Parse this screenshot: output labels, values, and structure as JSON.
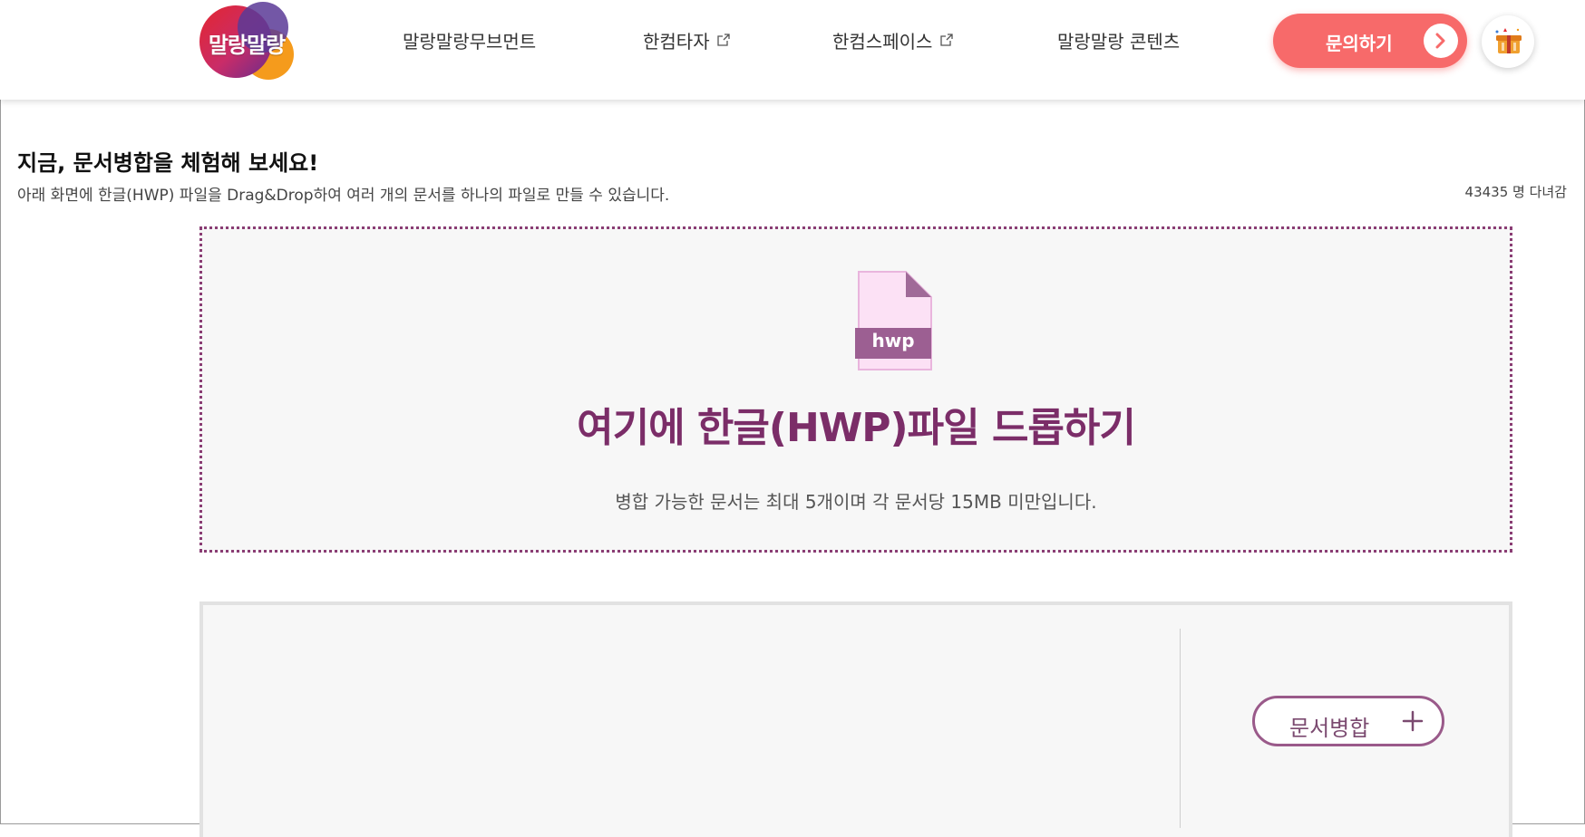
{
  "header": {
    "logo_text": "말랑말랑",
    "nav": [
      {
        "label": "말랑말랑무브먼트",
        "external": false
      },
      {
        "label": "한컴타자",
        "external": true
      },
      {
        "label": "한컴스페이스",
        "external": true
      },
      {
        "label": "말랑말랑 콘텐츠",
        "external": false
      }
    ],
    "contact_label": "문의하기"
  },
  "intro": {
    "title": "지금, 문서병합을 체험해 보세요!",
    "subtitle": "아래 화면에 한글(HWP) 파일을 Drag&Drop하여 여러 개의 문서를 하나의 파일로 만들 수 있습니다.",
    "visitor_count": "43435 명 다녀감"
  },
  "drop_zone": {
    "file_badge": "hwp",
    "title": "여기에 한글(HWP)파일 드롭하기",
    "hint": "병합 가능한 문서는 최대 5개이며 각 문서당 15MB  미만입니다."
  },
  "panel": {
    "merge_label": "문서병합"
  },
  "colors": {
    "accent_purple": "#7b2d68",
    "contact_red": "#f76a6a",
    "drop_border": "#8a3d74",
    "file_icon_fill": "#fce1f5",
    "file_icon_fold": "#a06a98",
    "file_badge_bg": "#9c5f92"
  },
  "icons": {
    "external": "external-link-icon",
    "arrow": "chevron-right-icon",
    "avatar": "gift-box-icon",
    "file": "hwp-file-icon",
    "plus": "plus-icon"
  }
}
